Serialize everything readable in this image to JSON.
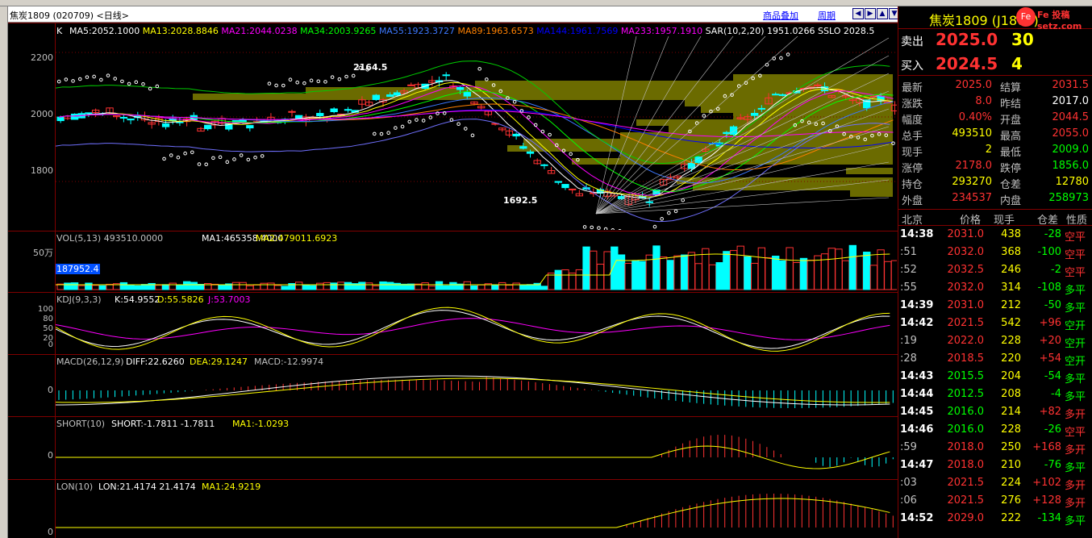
{
  "window": {
    "title": "焦炭1809 (020709) <日线>",
    "buttons": [
      "商品叠加",
      "周期"
    ],
    "icon_buttons": [
      "prev-icon",
      "next-icon",
      "zoom-in-icon",
      "zoom-out-icon"
    ]
  },
  "main_panel": {
    "legend_prefix": "K",
    "ma_labels": [
      {
        "text": "MA5:2052.1000",
        "color": "#ffffff"
      },
      {
        "text": "MA13:2028.8846",
        "color": "#ffff00"
      },
      {
        "text": "MA21:2044.0238",
        "color": "#ff00ff"
      },
      {
        "text": "MA34:2003.9265",
        "color": "#00ff00"
      },
      {
        "text": "MA55:1923.3727",
        "color": "#3c78ff"
      },
      {
        "text": "MA89:1963.6573",
        "color": "#ff8000"
      },
      {
        "text": "MA144:1961.7569",
        "color": "#0000ff"
      },
      {
        "text": "MA233:1957.1910",
        "color": "#ff00ff"
      },
      {
        "text": "SAR(10,2,20)  1951.0266",
        "color": "#ffffff"
      },
      {
        "text": "SSLO  2028.5",
        "color": "#ffffff"
      }
    ],
    "y_ticks": [
      "2200",
      "2000",
      "1800"
    ],
    "annotations": {
      "high": "2164.5",
      "low": "1692.5"
    }
  },
  "vol_panel": {
    "label": "VOL(5,13)  493510.0000",
    "ma1": "MA1:465358.4000",
    "ma2": "MA2:479011.6923",
    "y_tick": "50万",
    "cursor_value": "187952.4"
  },
  "kdj_panel": {
    "label": "KDJ(9,3,3)",
    "k": "K:54.9552",
    "d": "D:55.5826",
    "j": "J:53.7003",
    "y_ticks": [
      "100",
      "80",
      "50",
      "20",
      "0"
    ]
  },
  "macd_panel": {
    "label": "MACD(26,12,9)",
    "diff": "DIFF:22.6260",
    "dea": "DEA:29.1247",
    "macd": "MACD:-12.9974",
    "y_tick": "0"
  },
  "short_panel": {
    "label": "SHORT(10)",
    "short": "SHORT:-1.7811  -1.7811",
    "ma1": "MA1:-1.0293",
    "y_tick": "0"
  },
  "lon_panel": {
    "label": "LON(10)",
    "lon": "LON:21.4174  21.4174",
    "ma1": "MA1:24.9219",
    "y_tick": "0"
  },
  "quote": {
    "name": "焦炭1809 (J1809)",
    "logo": "Fe 投稿 setz.com",
    "sell_label": "卖出",
    "sell_price": "2025.0",
    "sell_vol": "30",
    "buy_label": "买入",
    "buy_price": "2024.5",
    "buy_vol": "4",
    "stats": [
      [
        "最新",
        "2025.0",
        "r",
        "结算",
        "2031.5",
        "r"
      ],
      [
        "涨跌",
        "8.0",
        "r",
        "昨结",
        "2017.0",
        "w"
      ],
      [
        "幅度",
        "0.40%",
        "r",
        "开盘",
        "2044.5",
        "r"
      ],
      [
        "总手",
        "493510",
        "y",
        "最高",
        "2055.0",
        "r"
      ],
      [
        "现手",
        "2",
        "y",
        "最低",
        "2009.0",
        "g"
      ],
      [
        "涨停",
        "2178.0",
        "r",
        "跌停",
        "1856.0",
        "g"
      ],
      [
        "持仓",
        "293270",
        "y",
        "仓差",
        "12780",
        "y"
      ],
      [
        "外盘",
        "234537",
        "r",
        "内盘",
        "258973",
        "g"
      ]
    ]
  },
  "ticks_header": [
    "北京",
    "价格",
    "现手",
    "仓差",
    "性质"
  ],
  "ticks": [
    [
      "14:38",
      "2031.0",
      "438",
      "-28",
      "空平",
      true
    ],
    [
      ":51",
      "2032.0",
      "368",
      "-100",
      "空平",
      false
    ],
    [
      ":52",
      "2032.5",
      "246",
      "-2",
      "空平",
      false
    ],
    [
      ":55",
      "2032.0",
      "314",
      "-108",
      "多平",
      false
    ],
    [
      "14:39",
      "2031.0",
      "212",
      "-50",
      "多平",
      true
    ],
    [
      "14:42",
      "2021.5",
      "542",
      "+96",
      "空开",
      true
    ],
    [
      ":19",
      "2022.0",
      "228",
      "+20",
      "空开",
      false
    ],
    [
      ":28",
      "2018.5",
      "220",
      "+54",
      "空开",
      false
    ],
    [
      "14:43",
      "2015.5",
      "204",
      "-54",
      "多平",
      true
    ],
    [
      "14:44",
      "2012.5",
      "208",
      "-4",
      "多平",
      true
    ],
    [
      "14:45",
      "2016.0",
      "214",
      "+82",
      "多开",
      true
    ],
    [
      "14:46",
      "2016.0",
      "228",
      "-26",
      "空平",
      true
    ],
    [
      ":59",
      "2018.0",
      "250",
      "+168",
      "多开",
      false
    ],
    [
      "14:47",
      "2018.0",
      "210",
      "-76",
      "多平",
      true
    ],
    [
      ":03",
      "2021.5",
      "224",
      "+102",
      "多开",
      false
    ],
    [
      ":06",
      "2021.5",
      "276",
      "+128",
      "多开",
      false
    ],
    [
      "14:52",
      "2029.0",
      "222",
      "-134",
      "多平",
      true
    ]
  ]
}
